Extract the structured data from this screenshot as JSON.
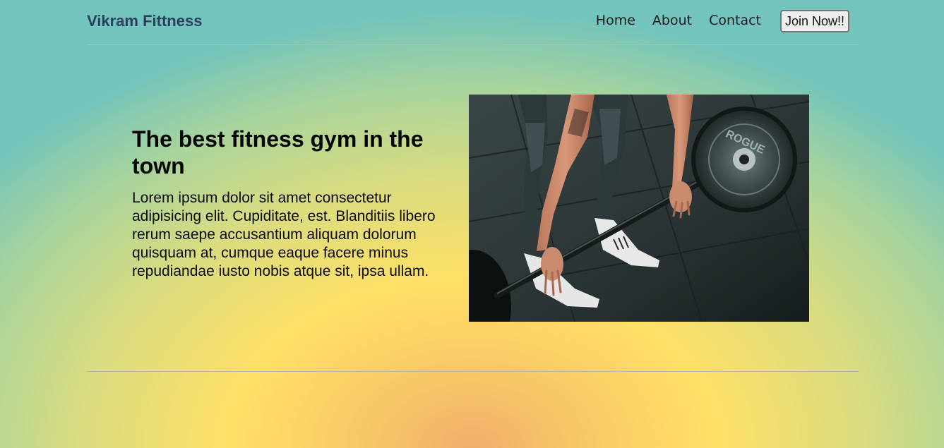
{
  "header": {
    "brand": "Vikram Fittness",
    "nav": [
      "Home",
      "About",
      "Contact"
    ],
    "cta_label": "Join Now!!"
  },
  "hero": {
    "title": "The best fitness gym in the town",
    "body": "Lorem ipsum dolor sit amet consectetur adipisicing elit. Cupiditate, est. Blanditiis libero rerum saepe accusantium aliquam dolorum quisquam at, cumque eaque facere minus repudiandae iusto nobis atque sit, ipsa ullam.",
    "image_subject": "deadlift-barbell-photo",
    "plate_lettering": "ROGUE"
  },
  "colors": {
    "brand": "#2c3e5e",
    "text": "#0a0a0a",
    "gradient_edge": "#72c4bc",
    "gradient_mid": "#ffe066",
    "gradient_center": "#f2ad6c"
  }
}
